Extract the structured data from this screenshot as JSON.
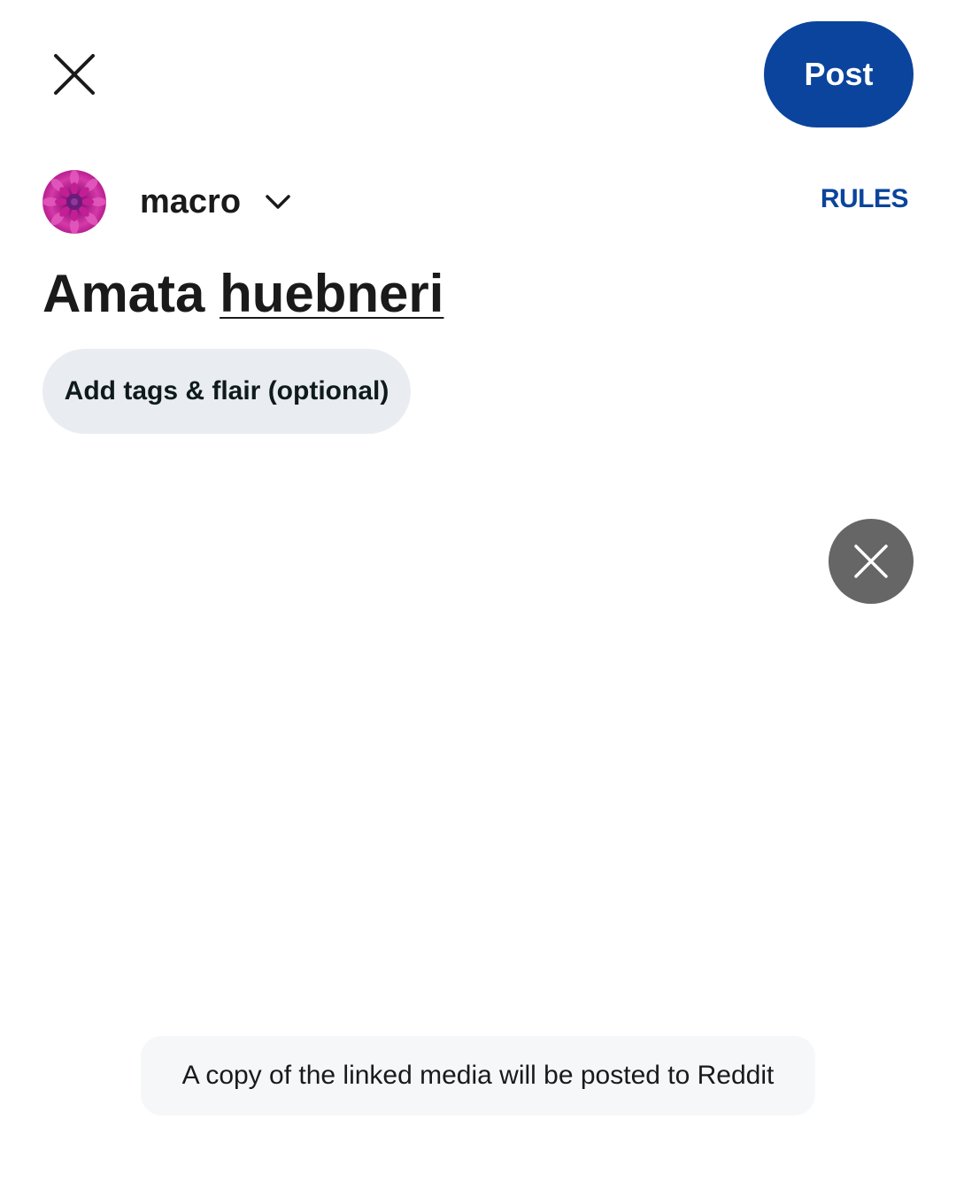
{
  "header": {
    "close_icon": "close-icon",
    "post_label": "Post",
    "accent_color": "#0b449c"
  },
  "community": {
    "avatar_icon": "dahlia-flower-avatar",
    "name": "macro",
    "dropdown_icon": "chevron-down-icon",
    "rules_label": "RULES"
  },
  "post": {
    "title_part1": "Amata",
    "title_part2": "huebneri",
    "tags_label": "Add tags & flair (optional)"
  },
  "media": {
    "remove_icon": "close-icon"
  },
  "notice": {
    "text": "A copy of the linked media will be posted to Reddit"
  }
}
